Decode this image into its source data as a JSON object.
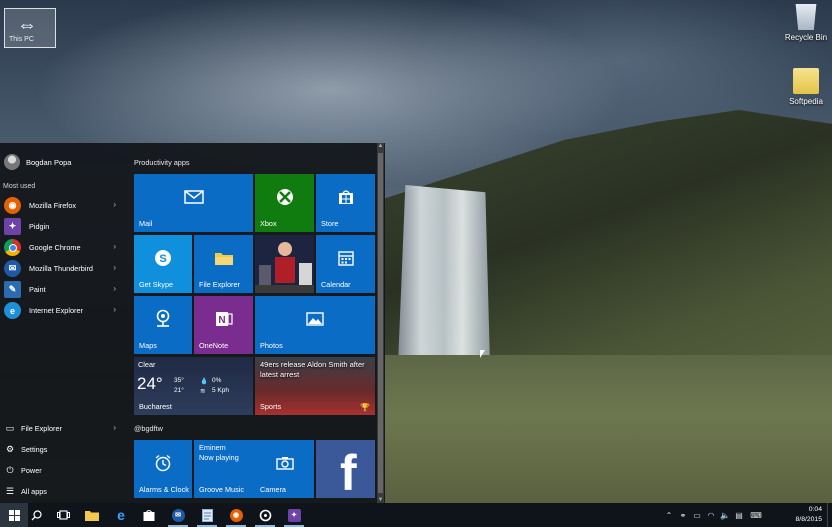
{
  "desktop": {
    "this_pc_label": "This PC",
    "icons": [
      {
        "label": "Recycle Bin",
        "icon": "recycle-bin-icon"
      },
      {
        "label": "Softpedia",
        "icon": "folder-icon"
      }
    ]
  },
  "start_menu": {
    "user_name": "Bogdan Popa",
    "most_used_label": "Most used",
    "apps": [
      {
        "label": "Mozilla Firefox",
        "icon": "firefox-icon",
        "color": "#e66000",
        "has_chevron": true
      },
      {
        "label": "Pidgin",
        "icon": "pidgin-icon",
        "color": "#6f42a8",
        "has_chevron": false
      },
      {
        "label": "Google Chrome",
        "icon": "chrome-icon",
        "color": "#d93025",
        "has_chevron": true
      },
      {
        "label": "Mozilla Thunderbird",
        "icon": "thunderbird-icon",
        "color": "#1f5aa6",
        "has_chevron": true
      },
      {
        "label": "Paint",
        "icon": "paint-icon",
        "color": "#2b6cb0",
        "has_chevron": true
      },
      {
        "label": "Internet Explorer",
        "icon": "ie-icon",
        "color": "#1e90d8",
        "has_chevron": true
      }
    ],
    "bottom_items": [
      {
        "label": "File Explorer",
        "icon": "folder-icon",
        "has_chevron": true
      },
      {
        "label": "Settings",
        "icon": "gear-icon",
        "has_chevron": false
      },
      {
        "label": "Power",
        "icon": "power-icon",
        "has_chevron": false
      },
      {
        "label": "All apps",
        "icon": "list-icon",
        "has_chevron": false
      }
    ],
    "groups": [
      {
        "title": "Productivity apps"
      },
      {
        "title": "@bgdftw"
      }
    ],
    "tiles": {
      "mail": "Mail",
      "xbox": "Xbox",
      "store": "Store",
      "skype": "Get Skype",
      "file_explorer": "File Explorer",
      "calendar": "Calendar",
      "maps": "Maps",
      "onenote": "OneNote",
      "photos": "Photos",
      "weather": {
        "condition": "Clear",
        "temp": "24°",
        "high": "35°",
        "low": "21°",
        "precip": "0%",
        "wind": "5 Kph",
        "city": "Bucharest"
      },
      "sports": {
        "headline": "49ers release Aldon Smith after latest arrest",
        "label": "Sports"
      },
      "groove": {
        "artist": "Eminem",
        "status": "Now playing",
        "label": "Groove Music"
      },
      "alarms": "Alarms & Clock",
      "camera": "Camera",
      "facebook": "f"
    }
  },
  "taskbar": {
    "clock_time": "0:04",
    "clock_date": "8/8/2015",
    "colors": {
      "accent": "#0a6cc4",
      "taskbar": "#0f141a",
      "xbox": "#107c10",
      "onenote": "#7a2c8f",
      "facebook": "#3b5998"
    }
  }
}
